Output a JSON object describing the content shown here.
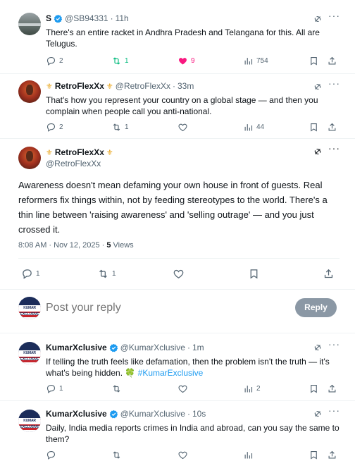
{
  "replies_top": [
    {
      "display_name": "S",
      "handle": "@SB94331",
      "time": "11h",
      "text": "There's an entire racket in Andhra Pradesh and Telangana for this. All are Telugus.",
      "replies": "2",
      "reposts": "1",
      "likes": "9",
      "views": "754"
    },
    {
      "display_name": "RetroFlexXx",
      "handle": "@RetroFlexXx",
      "time": "33m",
      "text": "That's how you represent your country on a global stage — and then you complain when people call you anti-national.",
      "replies": "2",
      "reposts": "1",
      "likes": "",
      "views": "44"
    }
  ],
  "main_tweet": {
    "display_name": "RetroFlexXx",
    "handle": "@RetroFlexXx",
    "text": "Awareness doesn't mean defaming your own house in front of guests. Real reformers fix things within, not by feeding stereotypes to the world. There's a thin line between 'raising awareness' and 'selling outrage' — and you just crossed it.",
    "timestamp": "8:08 AM · Nov 12, 2025 · ",
    "views_count": "5",
    "views_label": " Views",
    "replies": "1",
    "reposts": "1"
  },
  "reply_box": {
    "avatar_text": "KUMAR EXCLUSIVE",
    "placeholder": "Post your reply",
    "button_label": "Reply"
  },
  "replies_bottom": [
    {
      "display_name": "KumarXclusive",
      "handle": "@KumarXclusive",
      "time": "1m",
      "text": "If telling the truth feels like defamation, then the problem isn't the truth — it's what's being hidden. 🍀 ",
      "hashtag": "#KumarExclusive",
      "replies": "1",
      "views": "2"
    },
    {
      "display_name": "KumarXclusive",
      "handle": "@KumarXclusive",
      "time": "10s",
      "text": "Daily, India media reports crimes in India and abroad, can you say the same to them?"
    }
  ],
  "colors": {
    "accent": "#1d9bf0",
    "repost_active": "#00ba7c",
    "like_active": "#f91880",
    "muted": "#536471"
  }
}
